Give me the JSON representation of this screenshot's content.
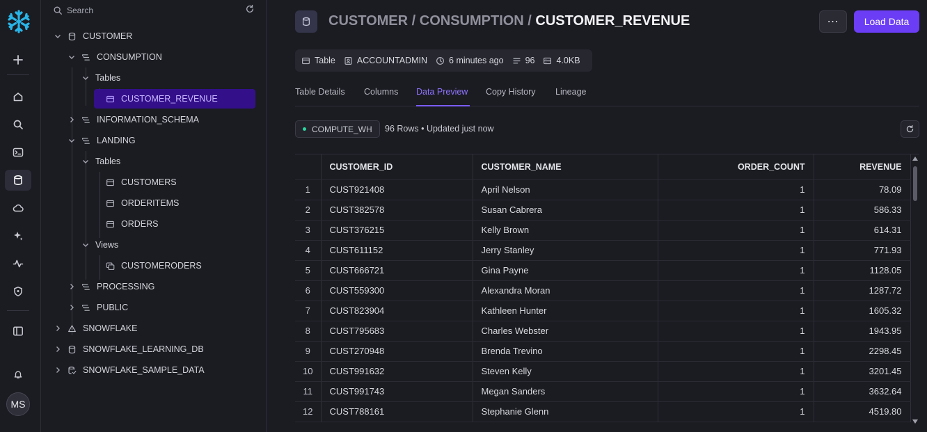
{
  "rail": {
    "avatar_initials": "MS",
    "icons": [
      "snowflake-logo",
      "plus-icon",
      "home-icon",
      "search-icon",
      "terminal-icon",
      "database-icon",
      "cloud-icon",
      "sparkle-icon",
      "activity-icon",
      "shield-icon",
      "panel-icon",
      "bell-icon"
    ]
  },
  "tree": {
    "search_placeholder": "Search",
    "nodes": [
      {
        "label": "CUSTOMER"
      },
      {
        "label": "CONSUMPTION"
      },
      {
        "label": "Tables"
      },
      {
        "label": "CUSTOMER_REVENUE"
      },
      {
        "label": "INFORMATION_SCHEMA"
      },
      {
        "label": "LANDING"
      },
      {
        "label": "Tables"
      },
      {
        "label": "CUSTOMERS"
      },
      {
        "label": "ORDERITEMS"
      },
      {
        "label": "ORDERS"
      },
      {
        "label": "Views"
      },
      {
        "label": "CUSTOMERODERS"
      },
      {
        "label": "PROCESSING"
      },
      {
        "label": "PUBLIC"
      },
      {
        "label": "SNOWFLAKE"
      },
      {
        "label": "SNOWFLAKE_LEARNING_DB"
      },
      {
        "label": "SNOWFLAKE_SAMPLE_DATA"
      }
    ]
  },
  "header": {
    "path_prefix": "CUSTOMER / CONSUMPTION / ",
    "current": "CUSTOMER_REVENUE",
    "more_label": "⋯",
    "load_label": "Load Data"
  },
  "meta": {
    "type": "Table",
    "owner": "ACCOUNTADMIN",
    "modified": "6 minutes ago",
    "rows": "96",
    "size": "4.0KB"
  },
  "tabs": [
    "Table Details",
    "Columns",
    "Data Preview",
    "Copy History",
    "Lineage"
  ],
  "active_tab": "Data Preview",
  "preview": {
    "warehouse": "COMPUTE_WH",
    "summary": "96 Rows • Updated just now",
    "columns": [
      "CUSTOMER_ID",
      "CUSTOMER_NAME",
      "ORDER_COUNT",
      "REVENUE"
    ],
    "rows": [
      {
        "n": "1",
        "id": "CUST921408",
        "name": "April Nelson",
        "count": "1",
        "revenue": "78.09"
      },
      {
        "n": "2",
        "id": "CUST382578",
        "name": "Susan Cabrera",
        "count": "1",
        "revenue": "586.33"
      },
      {
        "n": "3",
        "id": "CUST376215",
        "name": "Kelly Brown",
        "count": "1",
        "revenue": "614.31"
      },
      {
        "n": "4",
        "id": "CUST611152",
        "name": "Jerry Stanley",
        "count": "1",
        "revenue": "771.93"
      },
      {
        "n": "5",
        "id": "CUST666721",
        "name": "Gina Payne",
        "count": "1",
        "revenue": "1128.05"
      },
      {
        "n": "6",
        "id": "CUST559300",
        "name": "Alexandra Moran",
        "count": "1",
        "revenue": "1287.72"
      },
      {
        "n": "7",
        "id": "CUST823904",
        "name": "Kathleen Hunter",
        "count": "1",
        "revenue": "1605.32"
      },
      {
        "n": "8",
        "id": "CUST795683",
        "name": "Charles Webster",
        "count": "1",
        "revenue": "1943.95"
      },
      {
        "n": "9",
        "id": "CUST270948",
        "name": "Brenda Trevino",
        "count": "1",
        "revenue": "2298.45"
      },
      {
        "n": "10",
        "id": "CUST991632",
        "name": "Steven Kelly",
        "count": "1",
        "revenue": "3201.45"
      },
      {
        "n": "11",
        "id": "CUST991743",
        "name": "Megan Sanders",
        "count": "1",
        "revenue": "3632.64"
      },
      {
        "n": "12",
        "id": "CUST788161",
        "name": "Stephanie Glenn",
        "count": "1",
        "revenue": "4519.80"
      }
    ]
  },
  "colors": {
    "accent": "#6b3df5",
    "selected_bg": "#33108a",
    "active_tab": "#8f74ff",
    "warehouse_dot": "#2fd6a0",
    "logo": "#29b5e8"
  }
}
